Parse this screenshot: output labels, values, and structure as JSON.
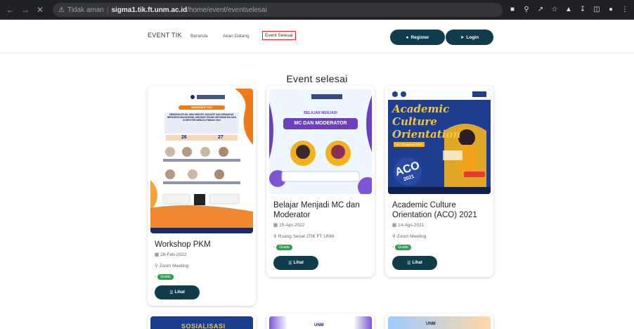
{
  "browser": {
    "insecure_label": "Tidak aman",
    "host": "sigma1.tik.ft.unm.ac.id",
    "path": "/home/event/eventselesai",
    "icons": [
      "back-icon",
      "forward-icon",
      "close-icon",
      "warning-icon",
      "translate-icon",
      "zoom-icon",
      "share-icon",
      "star-icon",
      "extension-icon",
      "download-icon",
      "sidepanel-icon",
      "profile-icon",
      "menu-icon"
    ]
  },
  "nav": {
    "brand": "EVENT TIK",
    "links": [
      "Beranda",
      "Akan Datang",
      "Event Selesai"
    ],
    "register_label": "Register",
    "login_label": "Login"
  },
  "page": {
    "title": "Event selesai"
  },
  "cards": [
    {
      "title": "Workshop PKM",
      "date": "26-Feb-2022",
      "location": "Zoom Meeting",
      "badge": "Gratis",
      "button": "Lihat",
      "poster": {
        "header": "WORKSHOP PKM",
        "headline": "MENINGKATKAN JIWA KREATIF, INOVATIF DAN SEMANGAT BERKARYA MAHASISWA JURUSAN TEKNIK INFORMATIKA DAN KOMPUTER MENUJU PIMNAS 2022",
        "day1": "26",
        "day2": "27"
      }
    },
    {
      "title": "Belajar Menjadi MC dan Moderator",
      "date": "15-Apr-2022",
      "location": "Ruang Senat JTIK FT UNM",
      "badge": "Gratis",
      "button": "Lihat",
      "poster": {
        "top": "BELAJAR MENJADI",
        "main": "MC DAN MODERATOR"
      }
    },
    {
      "title": "Academic Culture Orientation (ACO) 2021",
      "date": "14-Ags-2021",
      "location": "Zoom Meeting",
      "badge": "Gratis",
      "button": "Lihat",
      "poster": {
        "line1": "Academic",
        "line2": "Culture",
        "line3": "Orientation",
        "dates": "14 - 15 Agustus 2021",
        "aco": "ACO",
        "year": "2021"
      }
    }
  ],
  "next_row": {
    "poster1_text": "SOSIALISASI",
    "poster2_text": "UNM",
    "poster3_text": "UNM"
  },
  "colors": {
    "primary": "#0f3d4c",
    "badge": "#2e9f4f",
    "highlight": "#d32f2f"
  }
}
